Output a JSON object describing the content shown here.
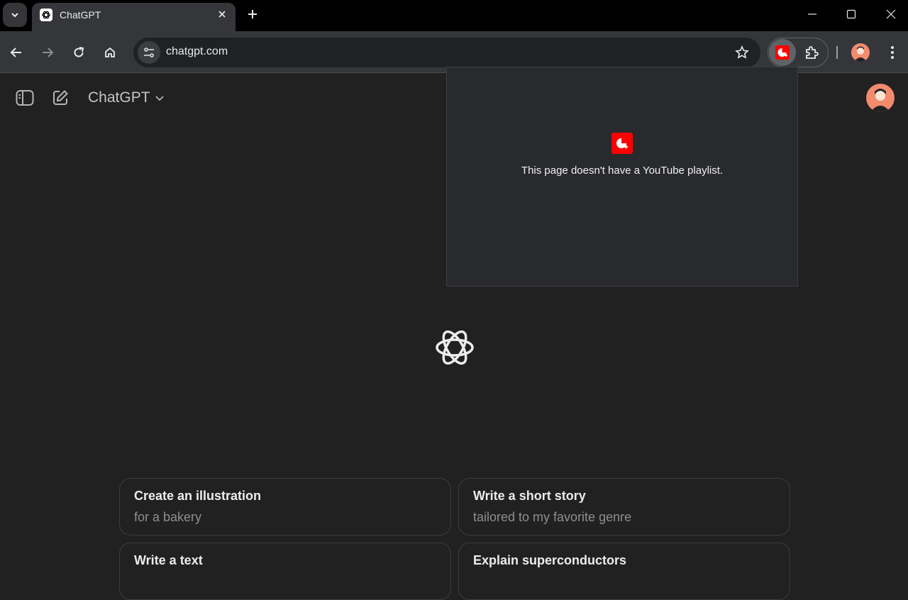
{
  "browser": {
    "tab_title": "ChatGPT",
    "url": "chatgpt.com"
  },
  "app": {
    "model_name": "ChatGPT"
  },
  "suggestions": [
    {
      "title": "Create an illustration",
      "subtitle": "for a bakery"
    },
    {
      "title": "Write a short story",
      "subtitle": "tailored to my favorite genre"
    },
    {
      "title": "Write a text",
      "subtitle": ""
    },
    {
      "title": "Explain superconductors",
      "subtitle": ""
    }
  ],
  "extension_popup": {
    "message": "This page doesn't have a YouTube playlist."
  },
  "colors": {
    "page_bg": "#212121",
    "extension_red": "#ff0000",
    "avatar_bg": "#f28b6e"
  }
}
